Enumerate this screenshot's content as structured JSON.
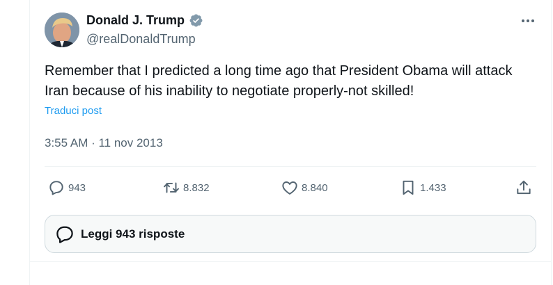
{
  "author": {
    "name": "Donald J. Trump",
    "handle": "@realDonaldTrump",
    "verified": true,
    "avatar_icon": "profile-photo"
  },
  "tweet": {
    "text": "Remember that I predicted a long time ago that President Obama will attack Iran because of his inability to negotiate properly-not skilled!",
    "translate_label": "Traduci post",
    "timestamp": "3:55 AM · 11 nov 2013"
  },
  "actions": {
    "replies": "943",
    "retweets": "8.832",
    "likes": "8.840",
    "bookmarks": "1.433"
  },
  "read_replies_label": "Leggi 943 risposte",
  "colors": {
    "accent": "#1d9bf0",
    "secondary_text": "#536471",
    "primary_text": "#0f1419"
  }
}
